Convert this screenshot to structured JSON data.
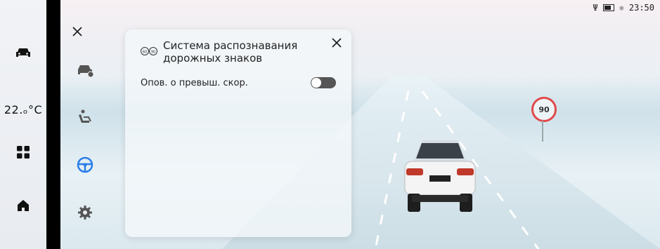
{
  "status_bar": {
    "time": "23:50"
  },
  "rail": {
    "temperature": "22.ₒ°C"
  },
  "panel": {
    "title": "Система распознавания дорожных знаков",
    "row_label": "Опов. о превыш. скор.",
    "toggle_on": false
  },
  "scene": {
    "speed_limit_sign": "90"
  },
  "colors": {
    "accent": "#2b7de9",
    "sign_red": "#e04a4a"
  }
}
